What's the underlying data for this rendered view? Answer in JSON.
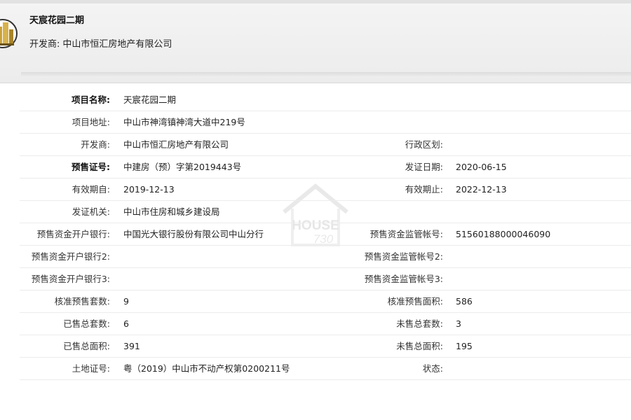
{
  "header": {
    "project_name": "天宸花园二期",
    "developer_label": "开发商:",
    "developer_name": "中山市恒汇房地产有限公司"
  },
  "rows": [
    {
      "l1": "项目名称:",
      "v1": "天宸花园二期",
      "l2": "",
      "v2": ""
    },
    {
      "l1": "项目地址:",
      "v1": "中山市神湾镇神湾大道中219号",
      "l2": "",
      "v2": ""
    },
    {
      "l1": "开发商:",
      "v1": "中山市恒汇房地产有限公司",
      "l2": "行政区划:",
      "v2": ""
    },
    {
      "l1": "预售证号:",
      "v1": "中建房（预）字第2019443号",
      "l2": "发证日期:",
      "v2": "2020-06-15"
    },
    {
      "l1": "有效期自:",
      "v1": "2019-12-13",
      "l2": "有效期止:",
      "v2": "2022-12-13"
    },
    {
      "l1": "发证机关:",
      "v1": "中山市住房和城乡建设局",
      "l2": "",
      "v2": ""
    },
    {
      "l1": "预售资金开户银行:",
      "v1": "中国光大银行股份有限公司中山分行",
      "l2": "预售资金监管帐号:",
      "v2": "51560188000046090"
    },
    {
      "l1": "预售资金开户银行2:",
      "v1": "",
      "l2": "预售资金监管帐号2:",
      "v2": ""
    },
    {
      "l1": "预售资金开户银行3:",
      "v1": "",
      "l2": "预售资金监管帐号3:",
      "v2": ""
    },
    {
      "l1": "核准预售套数:",
      "v1": "9",
      "l2": "核准预售面积:",
      "v2": "586"
    },
    {
      "l1": "已售总套数:",
      "v1": "6",
      "l2": "未售总套数:",
      "v2": "3"
    },
    {
      "l1": "已售总面积:",
      "v1": "391",
      "l2": "未售总面积:",
      "v2": "195"
    },
    {
      "l1": "土地证号:",
      "v1": "粤（2019）中山市不动产权第0200211号",
      "l2": "状态:",
      "v2": ""
    }
  ],
  "watermark": {
    "line1": "HOUSE",
    "line2": "730"
  },
  "colors": {
    "logo_gold": "#c9a23a",
    "logo_dark": "#6b5316",
    "watermark": "#e6e6e6"
  }
}
